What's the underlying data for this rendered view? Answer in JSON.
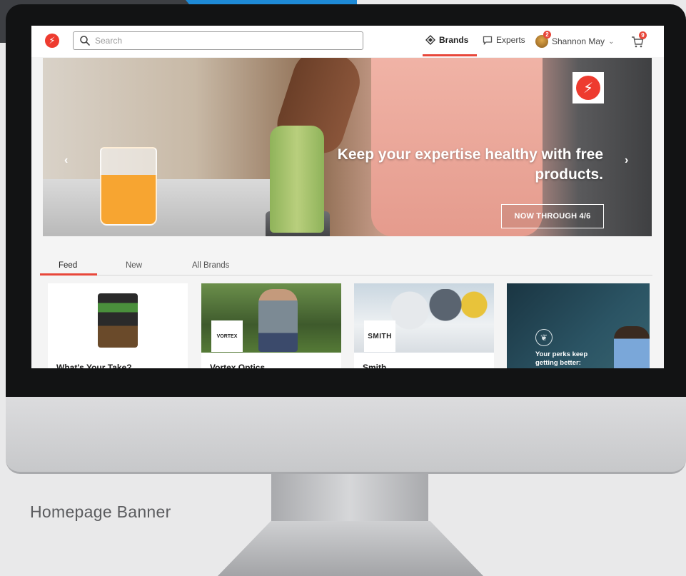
{
  "caption": "Homepage Banner",
  "nav": {
    "search_placeholder": "Search",
    "brands_label": "Brands",
    "experts_label": "Experts",
    "user_name": "Shannon May",
    "user_chevron": "⌄",
    "user_badge": "2",
    "cart_badge": "9"
  },
  "hero": {
    "headline": "Keep your expertise healthy with free products.",
    "cta_label": "NOW THROUGH 4/6",
    "prev_arrow": "‹",
    "next_arrow": "›"
  },
  "tabs": [
    {
      "label": "Feed",
      "active": true
    },
    {
      "label": "New",
      "active": false
    },
    {
      "label": "All Brands",
      "active": false
    }
  ],
  "cards": [
    {
      "title": "What's Your Take?"
    },
    {
      "title": "Vortex Optics",
      "logo_text": "VORTEX"
    },
    {
      "title": "Smith",
      "logo_text": "SMITH"
    },
    {
      "promo_text": "Your perks keep getting better:"
    }
  ],
  "colors": {
    "accent": "#e8473a",
    "brand_red": "#ee3b2f",
    "backdrop_blue": "#1e8ad6"
  }
}
